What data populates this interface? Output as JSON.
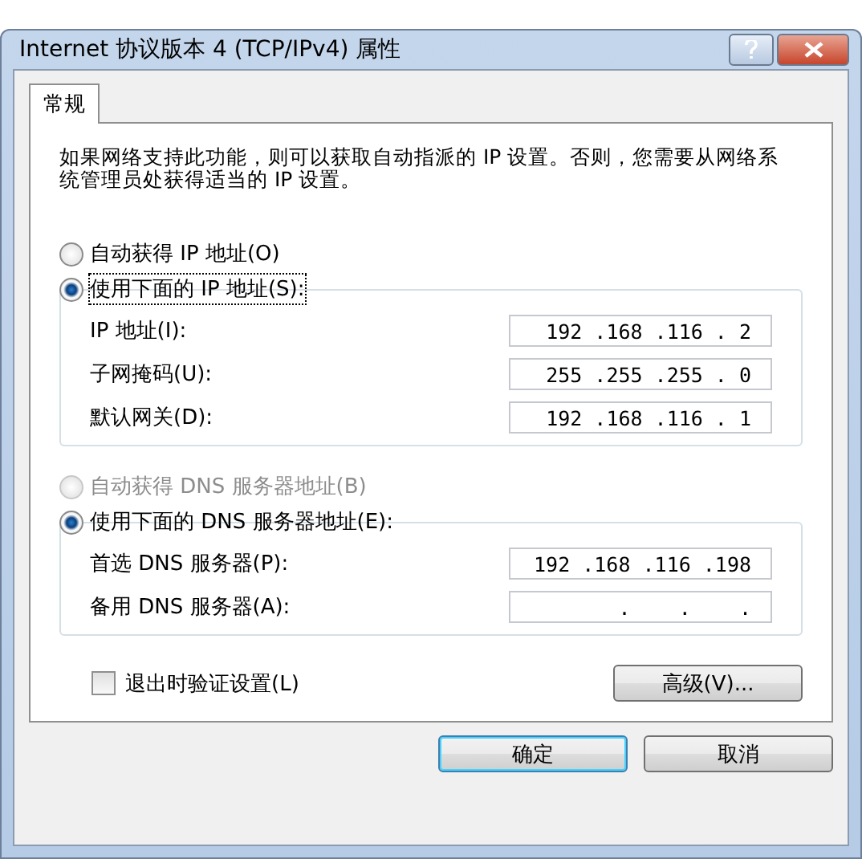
{
  "window": {
    "title": "Internet 协议版本 4 (TCP/IPv4) 属性"
  },
  "tabs": [
    {
      "label": "常规",
      "selected": true
    }
  ],
  "intro": "如果网络支持此功能，则可以获取自动指派的 IP 设置。否则，您需要从网络系统管理员处获得适当的 IP 设置。",
  "ip_section": {
    "options": [
      {
        "label": "自动获得 IP 地址(O)",
        "selected": false,
        "disabled": false
      },
      {
        "label": "使用下面的 IP 地址(S):",
        "selected": true,
        "disabled": false
      }
    ],
    "fields": [
      {
        "label": "IP 地址(I):",
        "value": "192 .168 .116 . 2"
      },
      {
        "label": "子网掩码(U):",
        "value": "255 .255 .255 . 0"
      },
      {
        "label": "默认网关(D):",
        "value": "192 .168 .116 . 1"
      }
    ]
  },
  "dns_section": {
    "options": [
      {
        "label": "自动获得 DNS 服务器地址(B)",
        "selected": false,
        "disabled": true
      },
      {
        "label": "使用下面的 DNS 服务器地址(E):",
        "selected": true,
        "disabled": false
      }
    ],
    "fields": [
      {
        "label": "首选 DNS 服务器(P):",
        "value": "192 .168 .116 .198"
      },
      {
        "label": "备用 DNS 服务器(A):",
        "value": ".    .    ."
      }
    ]
  },
  "validate_checkbox": {
    "label": "退出时验证设置(L)",
    "checked": false
  },
  "advanced_button": "高级(V)...",
  "buttons": [
    {
      "label": "确定",
      "default": true
    },
    {
      "label": "取消",
      "default": false
    }
  ]
}
